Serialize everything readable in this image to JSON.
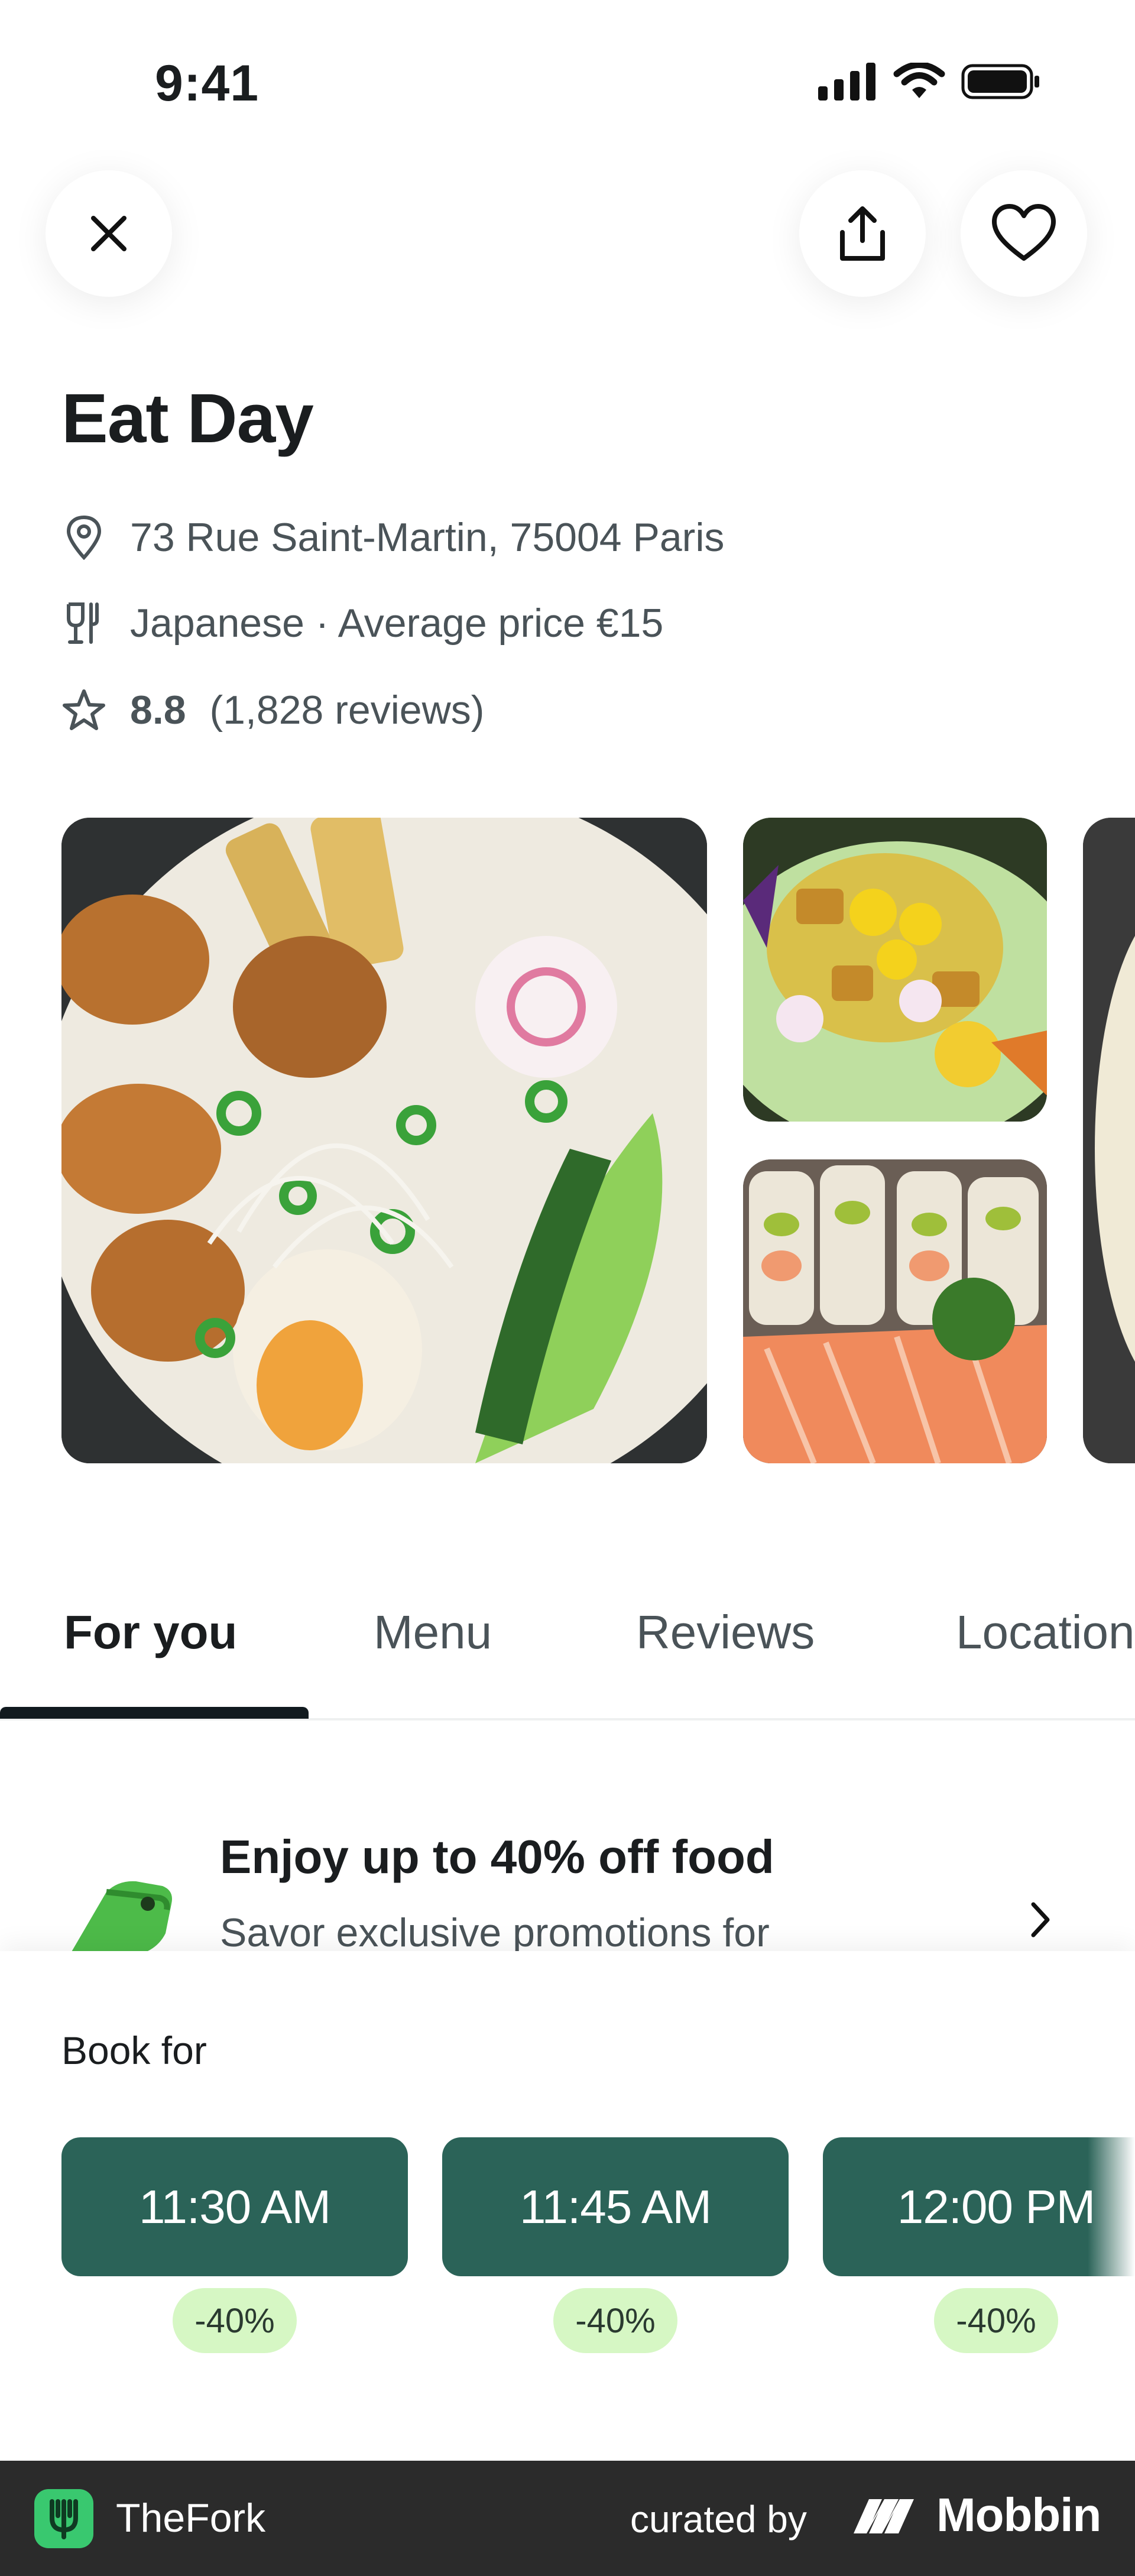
{
  "status_bar": {
    "time": "9:41"
  },
  "header": {
    "close_icon": "close-icon",
    "share_icon": "share-icon",
    "favorite_icon": "heart-icon"
  },
  "restaurant": {
    "name": "Eat Day",
    "address": "73 Rue Saint-Martin, 75004 Paris",
    "cuisine_price": "Japanese · Average price €15",
    "rating": "8.8",
    "reviews": "(1,828 reviews)"
  },
  "tabs": [
    {
      "label": "For you",
      "active": true
    },
    {
      "label": "Menu",
      "active": false
    },
    {
      "label": "Reviews",
      "active": false
    },
    {
      "label": "Location",
      "active": false
    }
  ],
  "promo": {
    "title": "Enjoy up to 40% off food",
    "subtitle": "Savor exclusive promotions for"
  },
  "booking": {
    "label": "Book for",
    "slots": [
      {
        "time": "11:30 AM",
        "discount": "-40%"
      },
      {
        "time": "11:45 AM",
        "discount": "-40%"
      },
      {
        "time": "12:00 PM",
        "discount": "-40%"
      }
    ]
  },
  "footer": {
    "brand": "TheFork",
    "curated_by": "curated by",
    "curator": "Mobbin"
  },
  "colors": {
    "primary_green": "#2b6358",
    "discount_bg": "#d6f7c4",
    "footer_bg": "#2b2b2b",
    "text_dark": "#1a1d1f",
    "text_muted": "#4a5358"
  }
}
